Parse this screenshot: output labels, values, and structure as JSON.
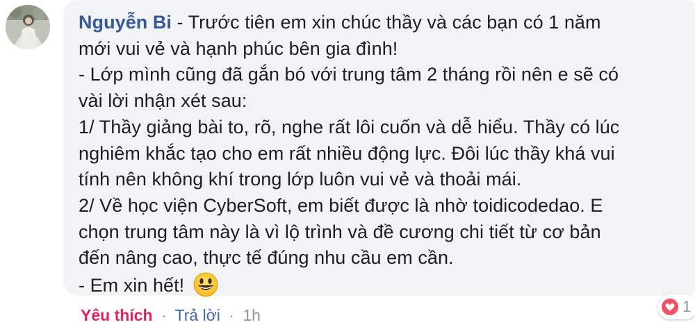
{
  "comment": {
    "author": "Nguyễn Bi",
    "text_lines": [
      " - Trước tiên em xin chúc thầy và các bạn có 1 năm",
      "mới vui vẻ và hạnh phúc bên gia đình!",
      "- Lớp mình cũng đã gắn bó với trung tâm 2 tháng rồi nên e sẽ có",
      "vài lời nhận xét sau:",
      "1/ Thầy giảng bài to, rõ, nghe rất lôi cuốn và dễ hiểu. Thầy có lúc",
      "nghiêm khắc tạo cho em rất nhiều động lực. Đôi lúc thầy khá vui",
      "tính nên không khí trong lớp luôn vui vẻ và thoải mái.",
      "2/ Về học viện CyberSoft, em biết được là nhờ toidicodedao. E",
      "chọn trung tâm này là vì lộ trình và đề cương chi tiết từ cơ bản",
      "đến nâng cao, thực tế đúng nhu cầu em cần.",
      "- Em xin hết! "
    ],
    "emoji": "grinning-face-emoji"
  },
  "actions": {
    "like_label": "Yêu thích",
    "separator": "·",
    "reply_label": "Trả lời",
    "time": "1h"
  },
  "reactions": {
    "icon": "heart-icon",
    "count": "1"
  },
  "colors": {
    "author": "#365899",
    "bubble_bg": "#f2f3f5",
    "like": "#e0245e",
    "reply": "#4267b2",
    "meta": "#90949c",
    "heart": "#f25268"
  }
}
